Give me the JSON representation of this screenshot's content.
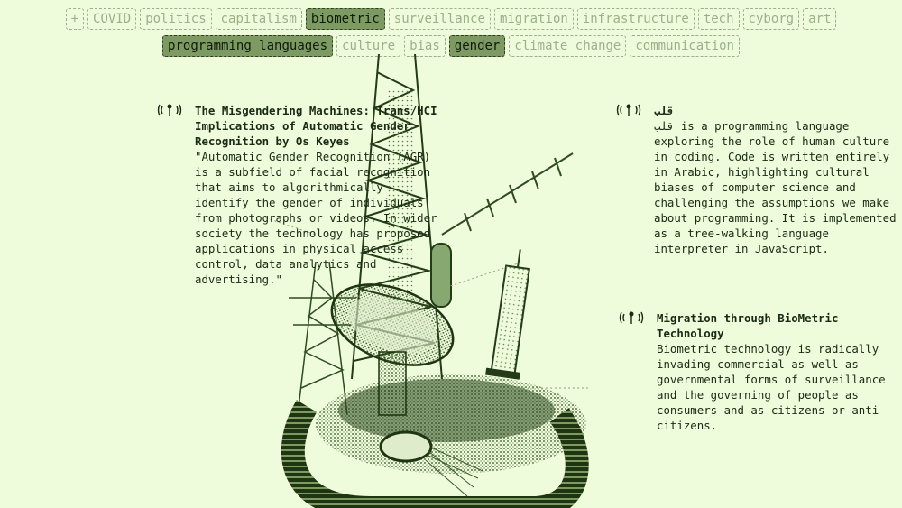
{
  "tags": {
    "row1": [
      {
        "label": "+",
        "active": false
      },
      {
        "label": "COVID",
        "active": false
      },
      {
        "label": "politics",
        "active": false
      },
      {
        "label": "capitalism",
        "active": false
      },
      {
        "label": "biometric",
        "active": true
      },
      {
        "label": "surveillance",
        "active": false
      },
      {
        "label": "migration",
        "active": false
      },
      {
        "label": "infrastructure",
        "active": false
      },
      {
        "label": "tech",
        "active": false
      },
      {
        "label": "cyborg",
        "active": false
      },
      {
        "label": "art",
        "active": false
      }
    ],
    "row2": [
      {
        "label": "programming languages",
        "active": true
      },
      {
        "label": "culture",
        "active": false
      },
      {
        "label": "bias",
        "active": false
      },
      {
        "label": "gender",
        "active": true
      },
      {
        "label": "climate change",
        "active": false
      },
      {
        "label": "communication",
        "active": false
      }
    ]
  },
  "entries": [
    {
      "icon": "broadcast-antenna-icon",
      "title": "The Misgendering Machines: Trans/HCI Implications of Automatic Gender Recognition by Os Keyes",
      "body": "\"Automatic Gender Recognition (AGR) is a subfield of facial recognition that aims to algorithmically identify the gender of individuals from photographs or videos. In wider society the technology has proposed applications in physical access control, data analytics and advertising.\""
    },
    {
      "icon": "broadcast-antenna-icon",
      "title": "قلب",
      "body": "قلب is a programming language exploring the role of human culture in coding. Code is written entirely in Arabic, highlighting cultural biases of computer science and challenging the assumptions we make about programming. It is implemented as a tree-walking language interpreter in JavaScript."
    },
    {
      "icon": "broadcast-antenna-icon",
      "title": "Migration through BioMetric Technology",
      "body": "Biometric technology is radically invading commercial as well as governmental forms of surveillance and the governing of people as consumers and as citizens or anti-citizens."
    }
  ],
  "colors": {
    "background": "#eefcdb",
    "tag_inactive": "#9db08a",
    "tag_active_fill": "#7e9a63",
    "ink": "#1a2a14",
    "art_dark": "#243b17"
  }
}
